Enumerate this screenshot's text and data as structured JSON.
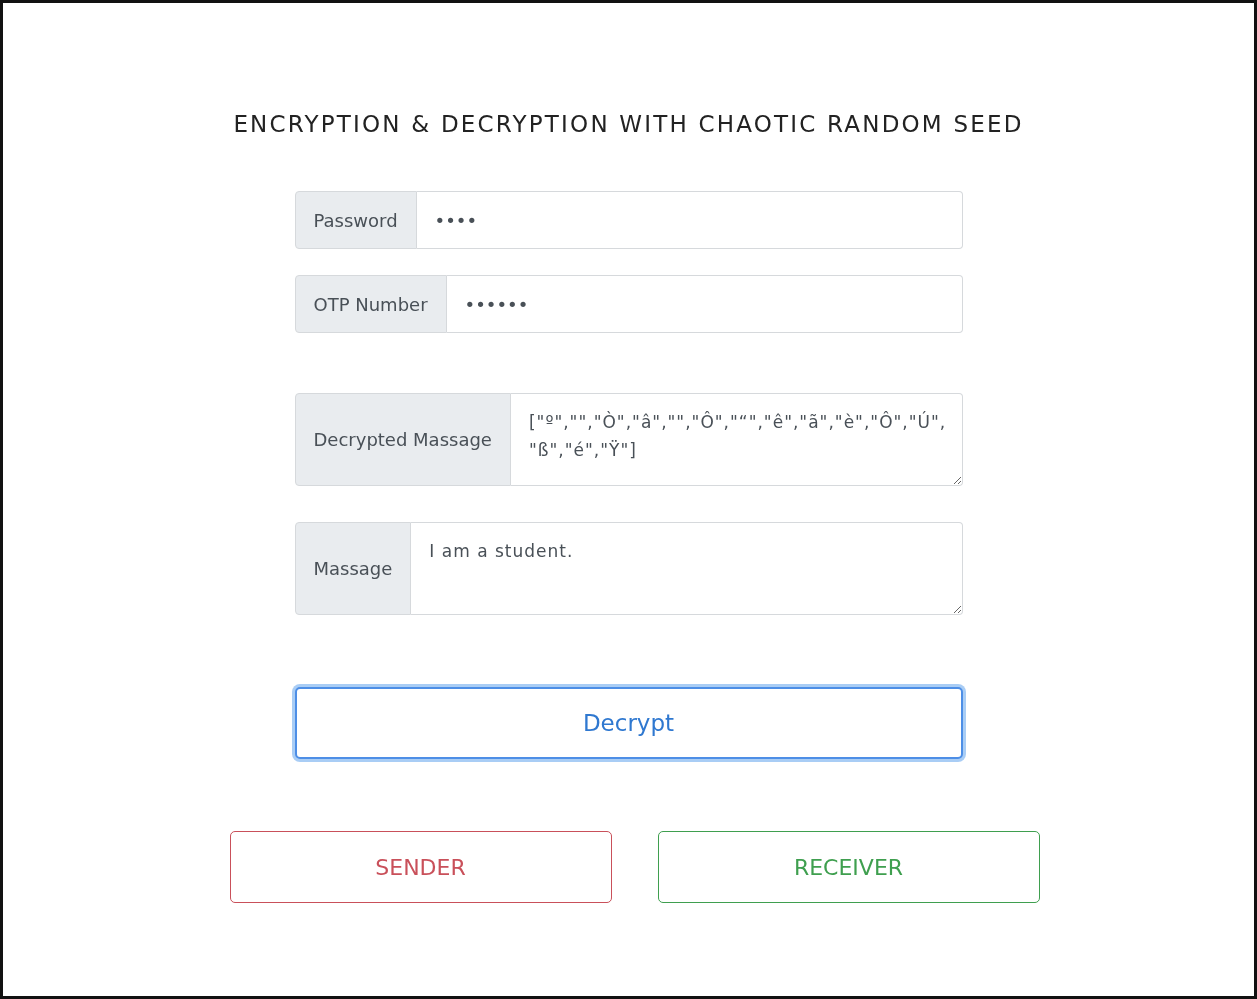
{
  "title": "ENCRYPTION & DECRYPTION WITH CHAOTIC RANDOM SEED",
  "fields": [
    {
      "kind": "input",
      "label": "Password",
      "value": "••••"
    },
    {
      "kind": "input",
      "label": "OTP Number",
      "value": "••••••"
    },
    {
      "kind": "textarea",
      "label": "Decrypted Massage",
      "value": "[\"º\",\"\",\"Ò\",\"â\",\"\",\"Ô\",\"“\",\"ê\",\"ã\",\"è\",\"Ô\",\"Ú\",\"ß\",\"é\",\"Ÿ\"]"
    },
    {
      "kind": "textarea",
      "label": "Massage",
      "value": "I am a student."
    }
  ],
  "action_button": {
    "label": "Decrypt",
    "focused": true
  },
  "mode_buttons": [
    {
      "label": "SENDER",
      "color": "#c9505a"
    },
    {
      "label": "RECEIVER",
      "color": "#3f9f4f"
    }
  ]
}
